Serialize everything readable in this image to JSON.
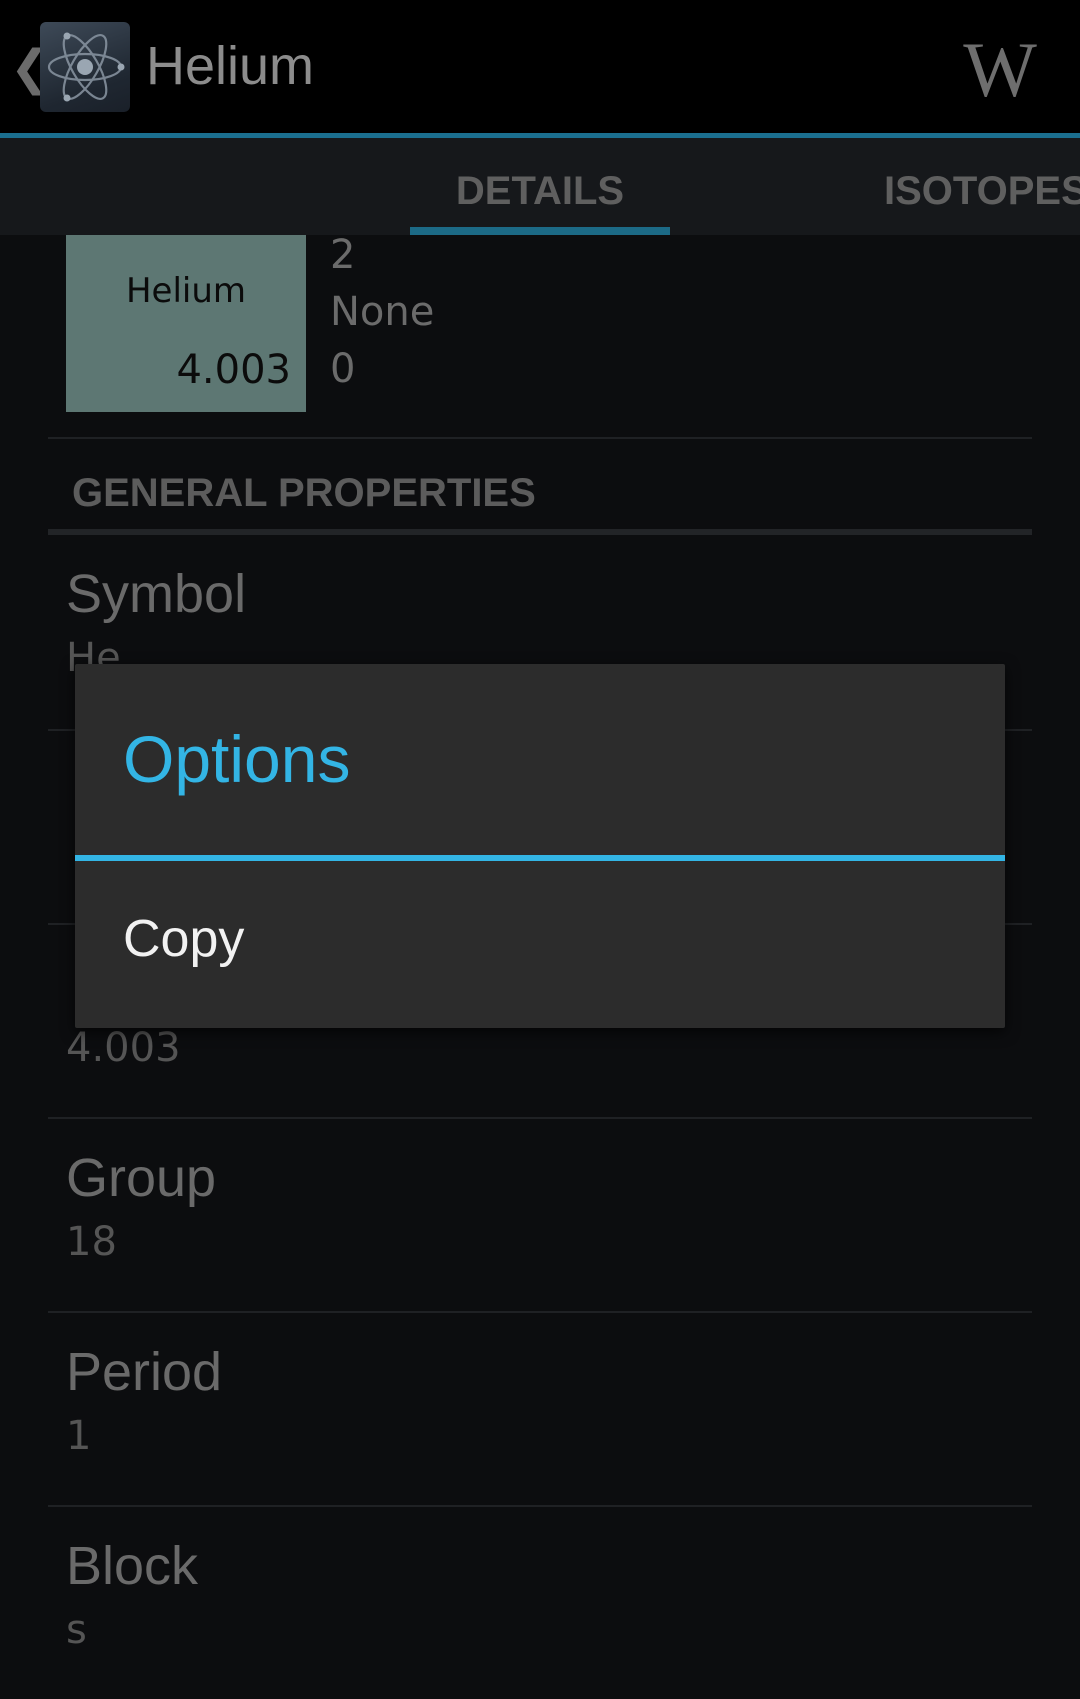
{
  "action_bar": {
    "back_glyph": "❮",
    "app_icon": "atom-icon",
    "title": "Helium",
    "wiki_label": "W"
  },
  "tabs": [
    {
      "label": "DETAILS",
      "selected": true
    },
    {
      "label": "ISOTOPES",
      "selected": false
    }
  ],
  "tab_indicator_color": "#1c6a86",
  "element_tile": {
    "name": "Helium",
    "weight": "4.003",
    "color": "#5d7773",
    "side_values": [
      "2",
      "None",
      "0"
    ]
  },
  "section": {
    "title": "GENERAL PROPERTIES"
  },
  "properties": [
    {
      "label": "Symbol",
      "value": "He"
    },
    {
      "label": "",
      "value": ""
    },
    {
      "label": "",
      "value": "4.003"
    },
    {
      "label": "Group",
      "value": "18"
    },
    {
      "label": "Period",
      "value": "1"
    },
    {
      "label": "Block",
      "value": "s"
    }
  ],
  "dialog": {
    "title": "Options",
    "items": [
      {
        "label": "Copy"
      }
    ],
    "accent_color": "#33b5e5"
  }
}
